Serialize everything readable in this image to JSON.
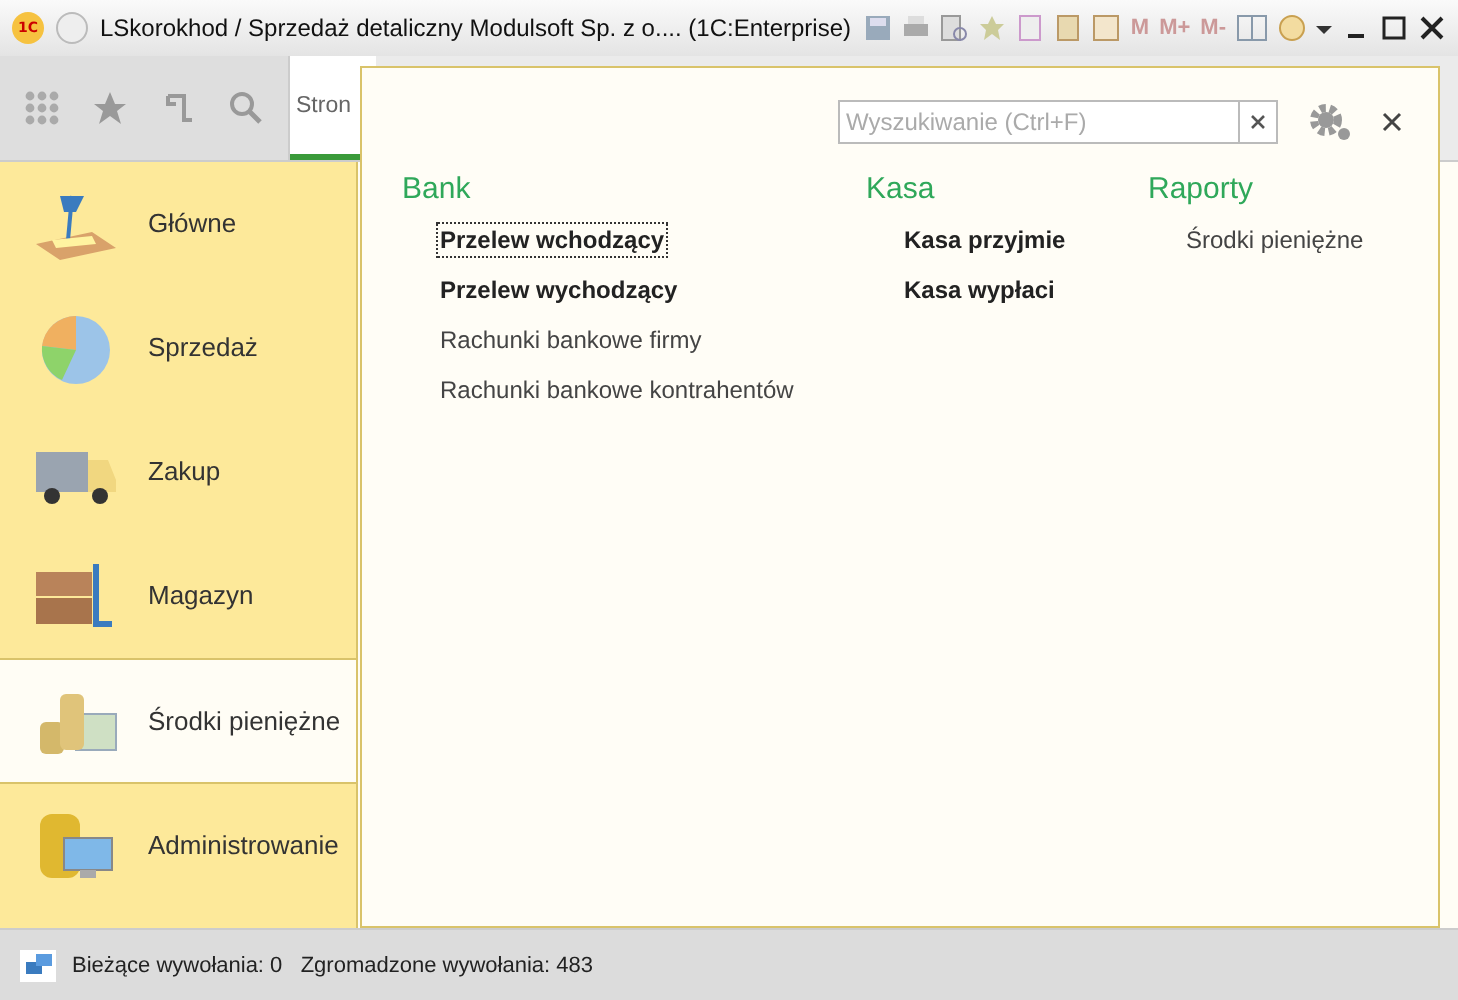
{
  "window": {
    "title": "LSkorokhod / Sprzedaż detaliczny Modulsoft Sp. z o....  (1C:Enterprise)",
    "logo": "1С",
    "memory_buttons": [
      "M",
      "M+",
      "M-"
    ]
  },
  "tabs": [
    {
      "label": "Stron",
      "selected": true
    }
  ],
  "sidebar": {
    "items": [
      {
        "label": "Główne",
        "kind": "lamp",
        "selected": false
      },
      {
        "label": "Sprzedaż",
        "kind": "pie",
        "selected": false
      },
      {
        "label": "Zakup",
        "kind": "truck",
        "selected": false
      },
      {
        "label": "Magazyn",
        "kind": "boxes",
        "selected": false
      },
      {
        "label": "Środki pieniężne",
        "kind": "coins",
        "selected": true
      },
      {
        "label": "Administrowanie",
        "kind": "database",
        "selected": false
      }
    ]
  },
  "panel": {
    "search": {
      "placeholder": "Wyszukiwanie (Ctrl+F)"
    },
    "groups": [
      {
        "title": "Bank",
        "links": [
          {
            "label": "Przelew wchodzący",
            "bold": true,
            "focused": true
          },
          {
            "label": "Przelew wychodzący",
            "bold": true,
            "focused": false
          },
          {
            "label": "Rachunki bankowe firmy",
            "bold": false,
            "focused": false
          },
          {
            "label": "Rachunki bankowe kontrahentów",
            "bold": false,
            "focused": false
          }
        ]
      },
      {
        "title": "Kasa",
        "links": [
          {
            "label": "Kasa przyjmie",
            "bold": true,
            "focused": false
          },
          {
            "label": "Kasa wypłaci",
            "bold": true,
            "focused": false
          }
        ]
      },
      {
        "title": "Raporty",
        "links": [
          {
            "label": "Środki pieniężne",
            "bold": false,
            "focused": false
          }
        ]
      }
    ]
  },
  "status_bar": {
    "text": "Bieżące wywołania: 0   Zgromadzone wywołania: 483"
  }
}
